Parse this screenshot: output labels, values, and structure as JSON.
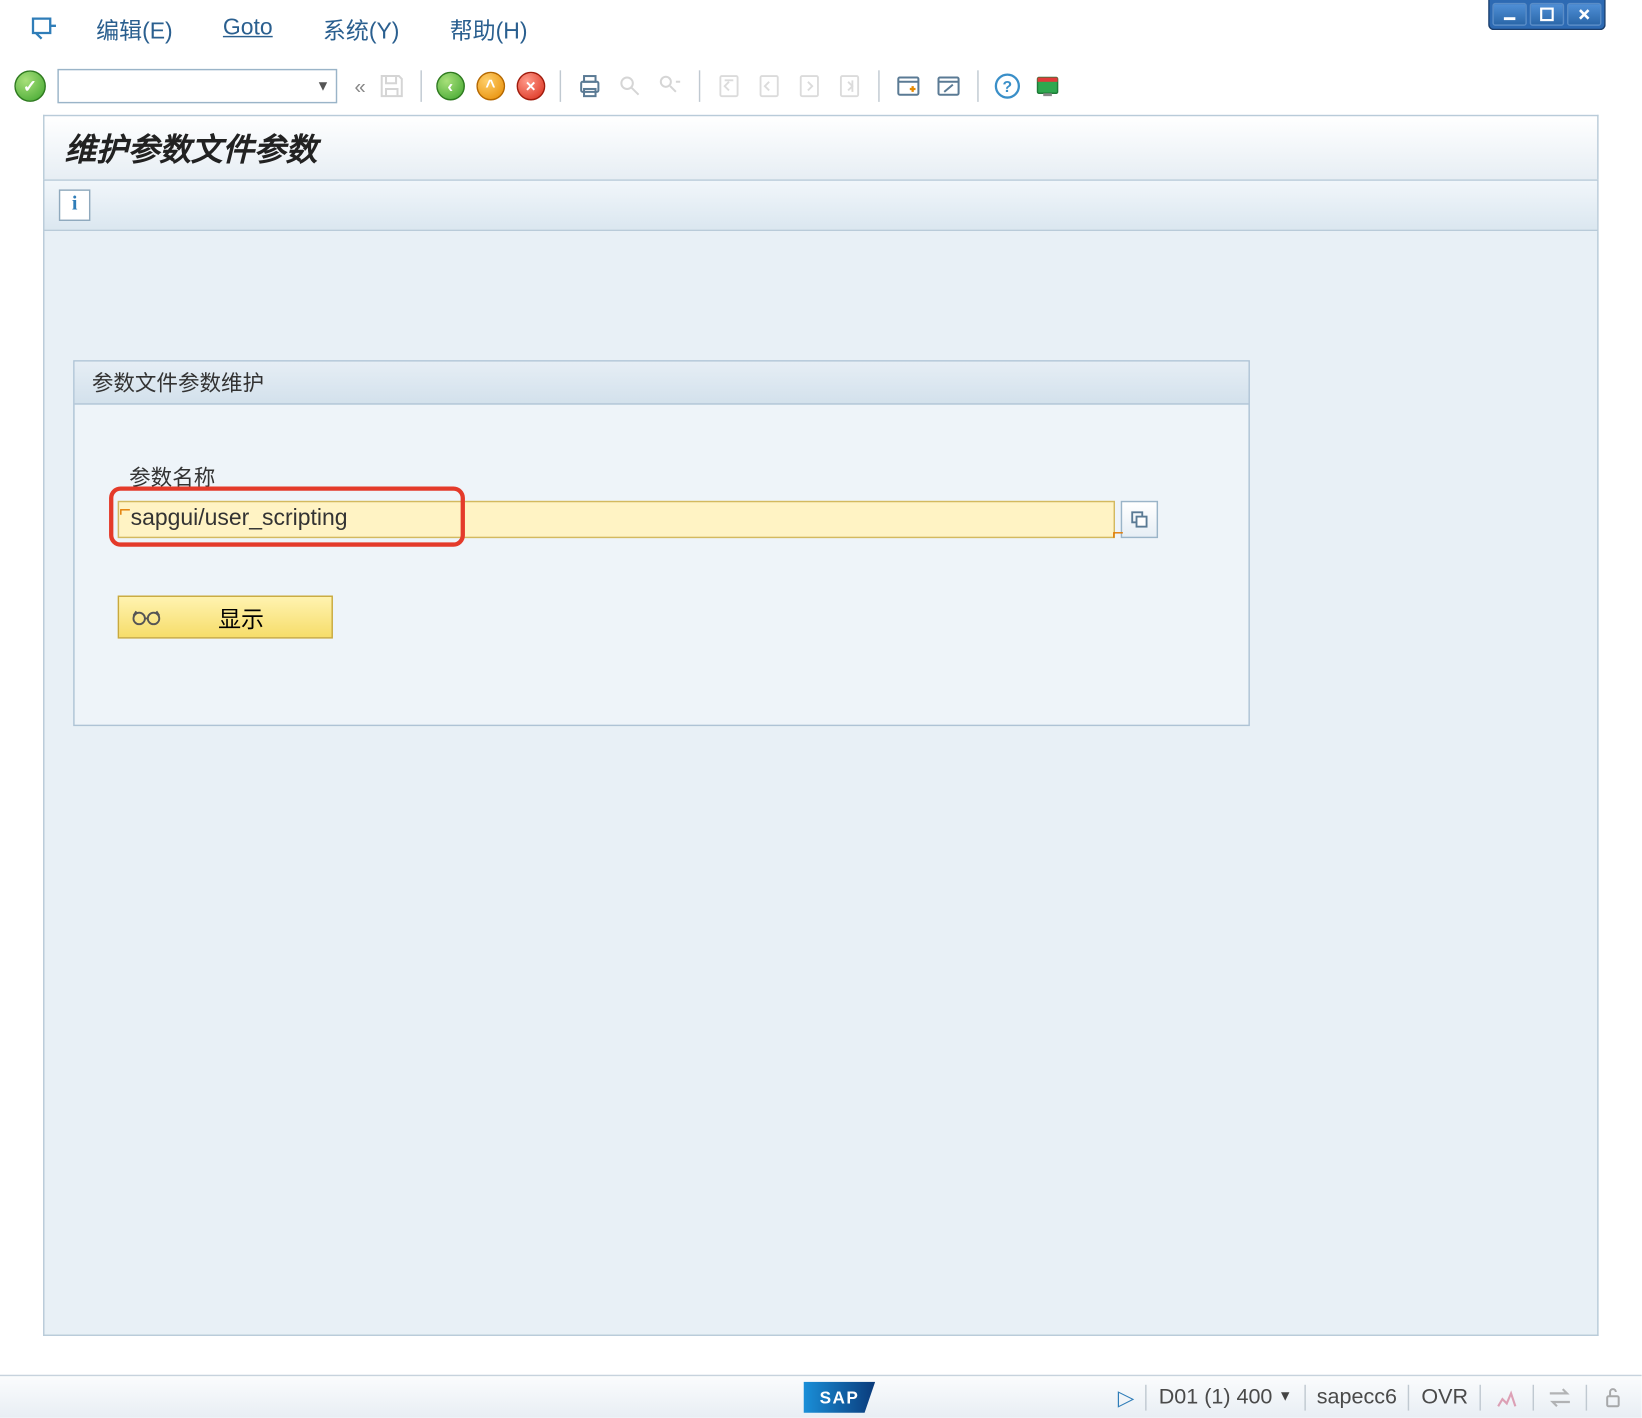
{
  "menubar": {
    "edit": "编辑(E)",
    "goto": "Goto",
    "system": "系统(Y)",
    "help": "帮助(H)"
  },
  "title": "维护参数文件参数",
  "groupbox": {
    "header": "参数文件参数维护",
    "param_label": "参数名称",
    "param_value": "sapgui/user_scripting",
    "display_label": "显示"
  },
  "statusbar": {
    "session": "D01 (1) 400",
    "host": "sapecc6",
    "mode": "OVR"
  },
  "icons": {
    "save": "save-icon",
    "back": "back-icon",
    "exit": "exit-icon",
    "cancel": "cancel-icon",
    "print": "print-icon",
    "find": "find-icon",
    "find_next": "find-next-icon",
    "first": "first-page-icon",
    "prev": "prev-page-icon",
    "next": "next-page-icon",
    "last": "last-page-icon",
    "new_session": "new-session-icon",
    "shortcut": "shortcut-icon",
    "help": "help-icon",
    "layout": "layout-icon",
    "info": "info-icon"
  }
}
